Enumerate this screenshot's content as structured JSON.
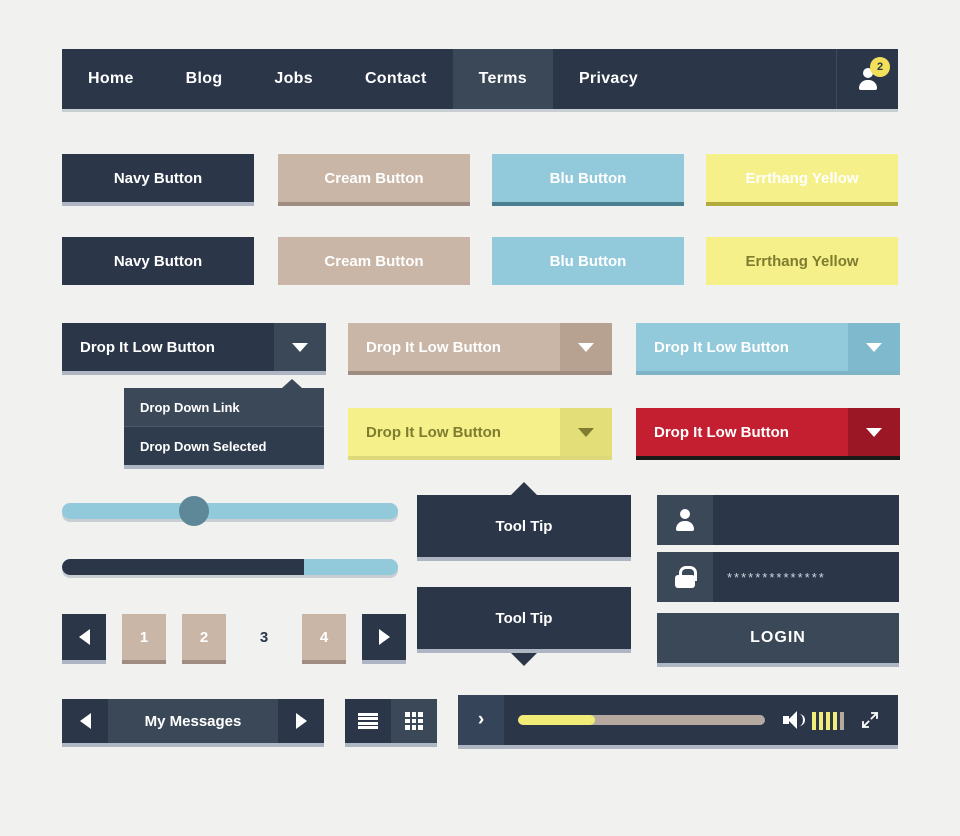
{
  "navbar": {
    "items": [
      {
        "label": "Home",
        "active": false
      },
      {
        "label": "Blog",
        "active": false
      },
      {
        "label": "Jobs",
        "active": false
      },
      {
        "label": "Contact",
        "active": false
      },
      {
        "label": "Terms",
        "active": true
      },
      {
        "label": "Privacy",
        "active": false
      }
    ],
    "user_icon": "user-icon",
    "badge_count": "2",
    "badge_color": "#f2e05a",
    "background": "#2b3749"
  },
  "buttons": {
    "row1": [
      {
        "label": "Navy Button",
        "style": "navy"
      },
      {
        "label": "Cream Button",
        "style": "cream"
      },
      {
        "label": "Blu Button",
        "style": "blu"
      },
      {
        "label": "Errthang Yellow",
        "style": "yellow"
      }
    ],
    "row2": [
      {
        "label": "Navy Button",
        "style": "navy"
      },
      {
        "label": "Cream Button",
        "style": "cream"
      },
      {
        "label": "Blu Button",
        "style": "blu"
      },
      {
        "label": "Errthang Yellow",
        "style": "yellow"
      }
    ]
  },
  "dropdowns": [
    {
      "label": "Drop It Low Button",
      "style": "navy"
    },
    {
      "label": "Drop It Low Button",
      "style": "cream"
    },
    {
      "label": "Drop It Low Button",
      "style": "blu"
    },
    {
      "label": "Drop It Low Button",
      "style": "yellow"
    },
    {
      "label": "Drop It Low Button",
      "style": "red"
    }
  ],
  "dropdown_menu": {
    "items": [
      {
        "label": "Drop Down Link",
        "selected": false
      },
      {
        "label": "Drop Down Selected",
        "selected": true
      }
    ]
  },
  "slider": {
    "handle_percent": "37",
    "track_color": "#92c9db",
    "handle_color": "#5e8897"
  },
  "progress": {
    "value_percent": "72",
    "fill_color": "#2b3749",
    "track_color": "#92c9db"
  },
  "tooltips": [
    {
      "label": "Tool Tip",
      "arrow": "up"
    },
    {
      "label": "Tool Tip",
      "arrow": "down"
    }
  ],
  "login": {
    "username": {
      "icon": "user-icon",
      "value": "",
      "placeholder": ""
    },
    "password": {
      "icon": "lock-icon",
      "value": "**************"
    },
    "submit_label": "LOGIN"
  },
  "pagination": {
    "prev_icon": "arrow-left-icon",
    "next_icon": "arrow-right-icon",
    "pages": [
      {
        "label": "1",
        "current": false
      },
      {
        "label": "2",
        "current": false
      },
      {
        "label": "3",
        "current": true
      },
      {
        "label": "4",
        "current": false
      }
    ]
  },
  "messages": {
    "prev_icon": "arrow-left-icon",
    "title": "My Messages",
    "next_icon": "arrow-right-icon"
  },
  "view_toggle": {
    "list_icon": "list-view-icon",
    "grid_icon": "grid-view-icon"
  },
  "player": {
    "play_label": "›",
    "progress_percent": "31",
    "progress_color": "#f0ec77",
    "volume_icon": "speaker-icon",
    "volume_bars_on": 4,
    "volume_bars_total": 5,
    "fullscreen_icon": "fullscreen-icon"
  }
}
